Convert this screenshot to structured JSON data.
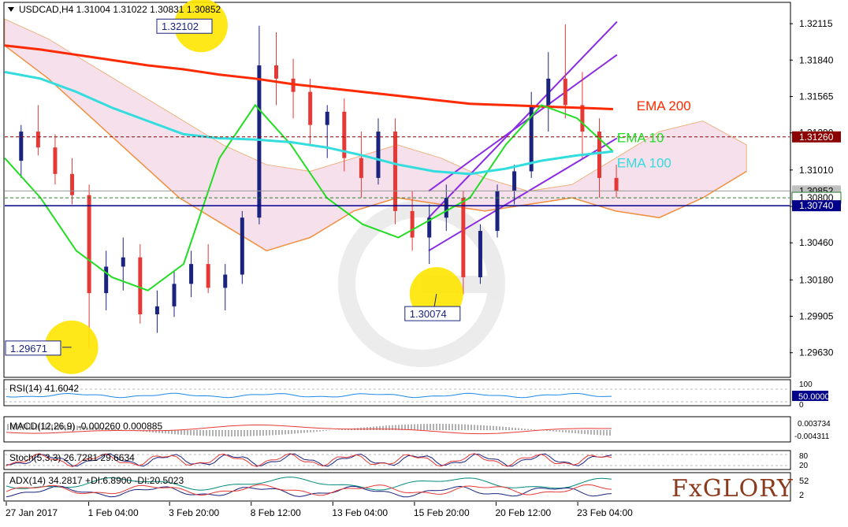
{
  "chart_data": {
    "type": "candlestick",
    "header": "USDCAD,H4  1.31004  1.31022  1.30831  1.30852",
    "price_axis": {
      "min": 1.2945,
      "max": 1.3227,
      "ticks": [
        "1.32115",
        "1.31840",
        "1.31565",
        "1.31290",
        "1.31010",
        "1.30735",
        "1.30460",
        "1.30180",
        "1.29905",
        "1.29630"
      ]
    },
    "time_labels": [
      "27 Jan 2017",
      "1 Feb 04:00",
      "3 Feb 20:00",
      "8 Feb 12:00",
      "13 Feb 04:00",
      "15 Feb 20:00",
      "20 Feb 12:00",
      "23 Feb 04:00"
    ],
    "price_tags": [
      {
        "text": "1.31260",
        "value": 1.3126,
        "fill": "#8b0000"
      },
      {
        "text": "1.30852",
        "value": 1.30852,
        "fill": "#c0c0c0"
      },
      {
        "text": "1.30800",
        "value": 1.308,
        "fill": "#ffffff"
      },
      {
        "text": "1.30740",
        "value": 1.3074,
        "fill": "#00008b"
      }
    ],
    "annotations": [
      {
        "text": "1.32102",
        "x": 0.25,
        "y": 1.32102
      },
      {
        "text": "1.30074",
        "x": 0.55,
        "y": 1.30074
      },
      {
        "text": "1.29671",
        "x": 0.085,
        "y": 1.29671
      }
    ],
    "ema_labels": [
      {
        "text": "EMA 200",
        "color": "#ff2a00",
        "x": 0.805,
        "y": 1.3146
      },
      {
        "text": "EMA 10",
        "color": "#22dd22",
        "x": 0.78,
        "y": 1.3122
      },
      {
        "text": "EMA 100",
        "color": "#33dddd",
        "x": 0.78,
        "y": 1.3103
      }
    ],
    "candles": [
      [
        1.3108,
        1.3135,
        1.3095,
        1.313
      ],
      [
        1.313,
        1.315,
        1.3112,
        1.3118
      ],
      [
        1.3118,
        1.3128,
        1.309,
        1.3098
      ],
      [
        1.3098,
        1.311,
        1.3075,
        1.3082
      ],
      [
        1.3082,
        1.309,
        1.2967,
        1.3008
      ],
      [
        1.3008,
        1.304,
        1.2995,
        1.3028
      ],
      [
        1.3028,
        1.305,
        1.301,
        1.3035
      ],
      [
        1.3035,
        1.3045,
        1.2985,
        1.2992
      ],
      [
        1.2992,
        1.301,
        1.2978,
        1.2998
      ],
      [
        1.2998,
        1.3025,
        1.299,
        1.3015
      ],
      [
        1.3015,
        1.304,
        1.3005,
        1.303
      ],
      [
        1.303,
        1.3045,
        1.3008,
        1.3012
      ],
      [
        1.3012,
        1.303,
        1.2995,
        1.3022
      ],
      [
        1.3022,
        1.307,
        1.3015,
        1.3065
      ],
      [
        1.3065,
        1.321,
        1.306,
        1.318
      ],
      [
        1.318,
        1.3205,
        1.315,
        1.317
      ],
      [
        1.317,
        1.3185,
        1.314,
        1.316
      ],
      [
        1.316,
        1.317,
        1.312,
        1.3135
      ],
      [
        1.3135,
        1.315,
        1.311,
        1.3145
      ],
      [
        1.3145,
        1.3155,
        1.31,
        1.311
      ],
      [
        1.311,
        1.313,
        1.308,
        1.3095
      ],
      [
        1.3095,
        1.314,
        1.309,
        1.313
      ],
      [
        1.313,
        1.314,
        1.306,
        1.307
      ],
      [
        1.307,
        1.3085,
        1.304,
        1.305
      ],
      [
        1.305,
        1.3075,
        1.303,
        1.3065
      ],
      [
        1.3065,
        1.309,
        1.3055,
        1.308
      ],
      [
        1.308,
        1.3085,
        1.3007,
        1.302
      ],
      [
        1.302,
        1.306,
        1.3015,
        1.3055
      ],
      [
        1.3055,
        1.309,
        1.305,
        1.3085
      ],
      [
        1.3085,
        1.3105,
        1.3075,
        1.31
      ],
      [
        1.31,
        1.316,
        1.3095,
        1.315
      ],
      [
        1.315,
        1.319,
        1.313,
        1.317
      ],
      [
        1.317,
        1.3211,
        1.314,
        1.315
      ],
      [
        1.315,
        1.3175,
        1.311,
        1.313
      ],
      [
        1.313,
        1.314,
        1.308,
        1.3095
      ],
      [
        1.3095,
        1.3105,
        1.308,
        1.3085
      ]
    ],
    "series": [
      {
        "name": "EMA 200",
        "color": "#ff2a00",
        "values": [
          1.3195,
          1.3192,
          1.3188,
          1.3184,
          1.318,
          1.3177,
          1.3173,
          1.317,
          1.3166,
          1.3163,
          1.316,
          1.3157,
          1.3154,
          1.3151,
          1.315,
          1.3149,
          1.3148,
          1.3147
        ]
      },
      {
        "name": "EMA 10",
        "color": "#22dd22",
        "values": [
          1.311,
          1.308,
          1.304,
          1.302,
          1.301,
          1.303,
          1.311,
          1.315,
          1.312,
          1.308,
          1.306,
          1.305,
          1.3065,
          1.308,
          1.312,
          1.315,
          1.314,
          1.3115
        ]
      },
      {
        "name": "EMA 100",
        "color": "#33dddd",
        "values": [
          1.3175,
          1.317,
          1.316,
          1.3148,
          1.3138,
          1.3128,
          1.3125,
          1.3124,
          1.3122,
          1.3118,
          1.3112,
          1.3105,
          1.31,
          1.3098,
          1.3102,
          1.3108,
          1.3112,
          1.3115
        ]
      }
    ],
    "channel": {
      "lower_start": 1.304,
      "lower_end": 1.3125,
      "upper_start": 1.3085,
      "upper_end": 1.3188
    },
    "indicators": {
      "rsi": {
        "label": "RSI(14) 41.6042",
        "ticks": [
          "100",
          "50.0000",
          "0"
        ]
      },
      "macd": {
        "label": "MACD(12,26,9) -0.000260 0.000885",
        "ticks": [
          "0.003734",
          "-0.004311"
        ]
      },
      "stoch": {
        "label": "Stoch(5,3,3) 26.7281 29.6634",
        "ticks": [
          "80",
          "20"
        ]
      },
      "adx": {
        "label": "ADX(14) 34.2817 +DI:6.8900 -DI:20.5023",
        "ticks": [
          "52",
          "2"
        ]
      }
    }
  },
  "brand": {
    "logo_text": "FxGLORY"
  }
}
